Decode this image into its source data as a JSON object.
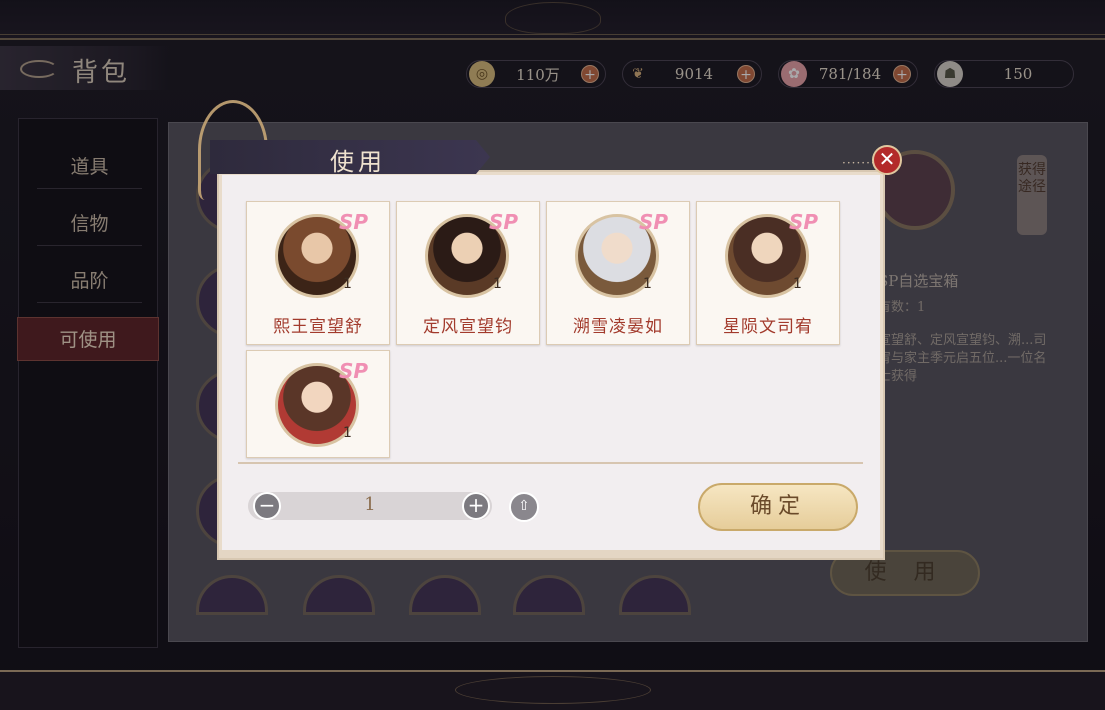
{
  "header": {
    "title": "背包",
    "currencies": [
      {
        "icon": "coin-icon",
        "value": "110万"
      },
      {
        "icon": "leaf-icon",
        "value": "9014"
      },
      {
        "icon": "flower-icon",
        "value": "781/184"
      },
      {
        "icon": "scroll-icon",
        "value": "150"
      }
    ]
  },
  "nav": {
    "items": [
      {
        "label": "道具"
      },
      {
        "label": "信物"
      },
      {
        "label": "品阶"
      },
      {
        "label": "可使用"
      }
    ],
    "active_index": 3
  },
  "side_tag": "获得途径",
  "detail": {
    "name": "SP自选宝箱",
    "owned": "有数：1",
    "description": "宣望舒、定风宣望钧、溯...司宥与家主季元启五位...一位名士获得",
    "use_label": "使 用"
  },
  "dialog": {
    "title": "使用",
    "close_symbol": "✕",
    "cards": [
      {
        "name": "熙王宣望舒",
        "badge": "SP",
        "count": "1"
      },
      {
        "name": "定风宣望钧",
        "badge": "SP",
        "count": "1"
      },
      {
        "name": "溯雪凌晏如",
        "badge": "SP",
        "count": "1"
      },
      {
        "name": "星陨文司宥",
        "badge": "SP",
        "count": "1"
      },
      {
        "name": "",
        "badge": "SP",
        "count": "1"
      }
    ],
    "quantity": "1",
    "minus_symbol": "−",
    "plus_symbol": "+",
    "confirm_label": "确定"
  }
}
